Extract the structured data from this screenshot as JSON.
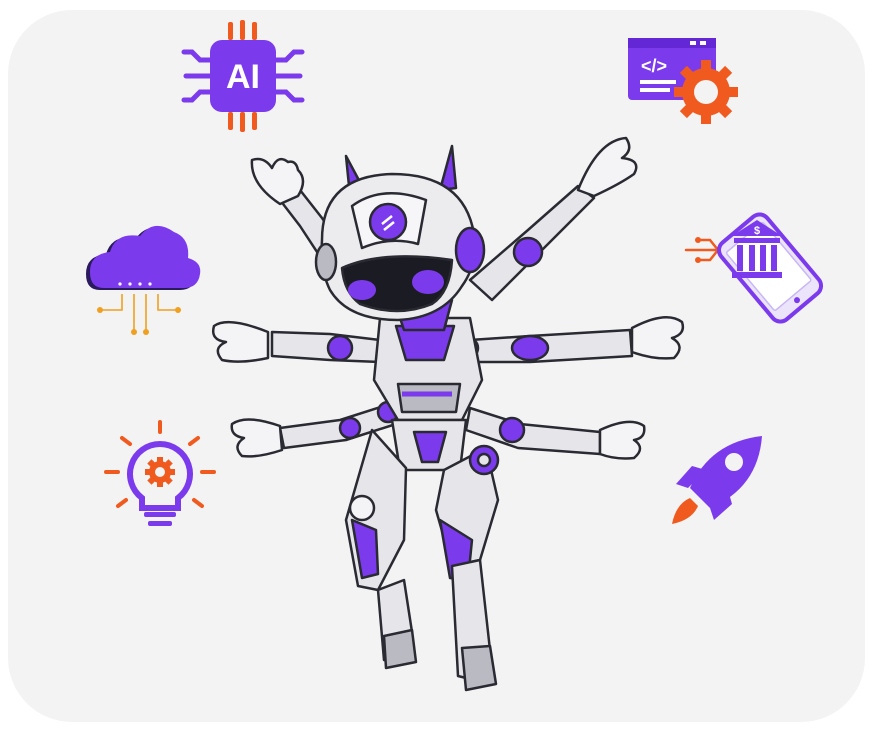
{
  "illustration": {
    "colors": {
      "background": "#f3f3f3",
      "purple": "#7c3aed",
      "purple_dark": "#5b21b6",
      "orange": "#f05a1e",
      "robot_body": "#e6e6ea",
      "robot_shadow": "#b9bac2",
      "outline": "#2a2a33"
    },
    "icons": [
      {
        "name": "ai-chip-icon",
        "text": "AI"
      },
      {
        "name": "code-window-gear-icon",
        "text": "</>"
      },
      {
        "name": "cloud-network-icon",
        "text": ""
      },
      {
        "name": "mobile-bank-icon",
        "text": "$"
      },
      {
        "name": "lightbulb-gear-icon",
        "text": ""
      },
      {
        "name": "rocket-icon",
        "text": ""
      }
    ],
    "robot": {
      "arm_count": 6
    }
  }
}
